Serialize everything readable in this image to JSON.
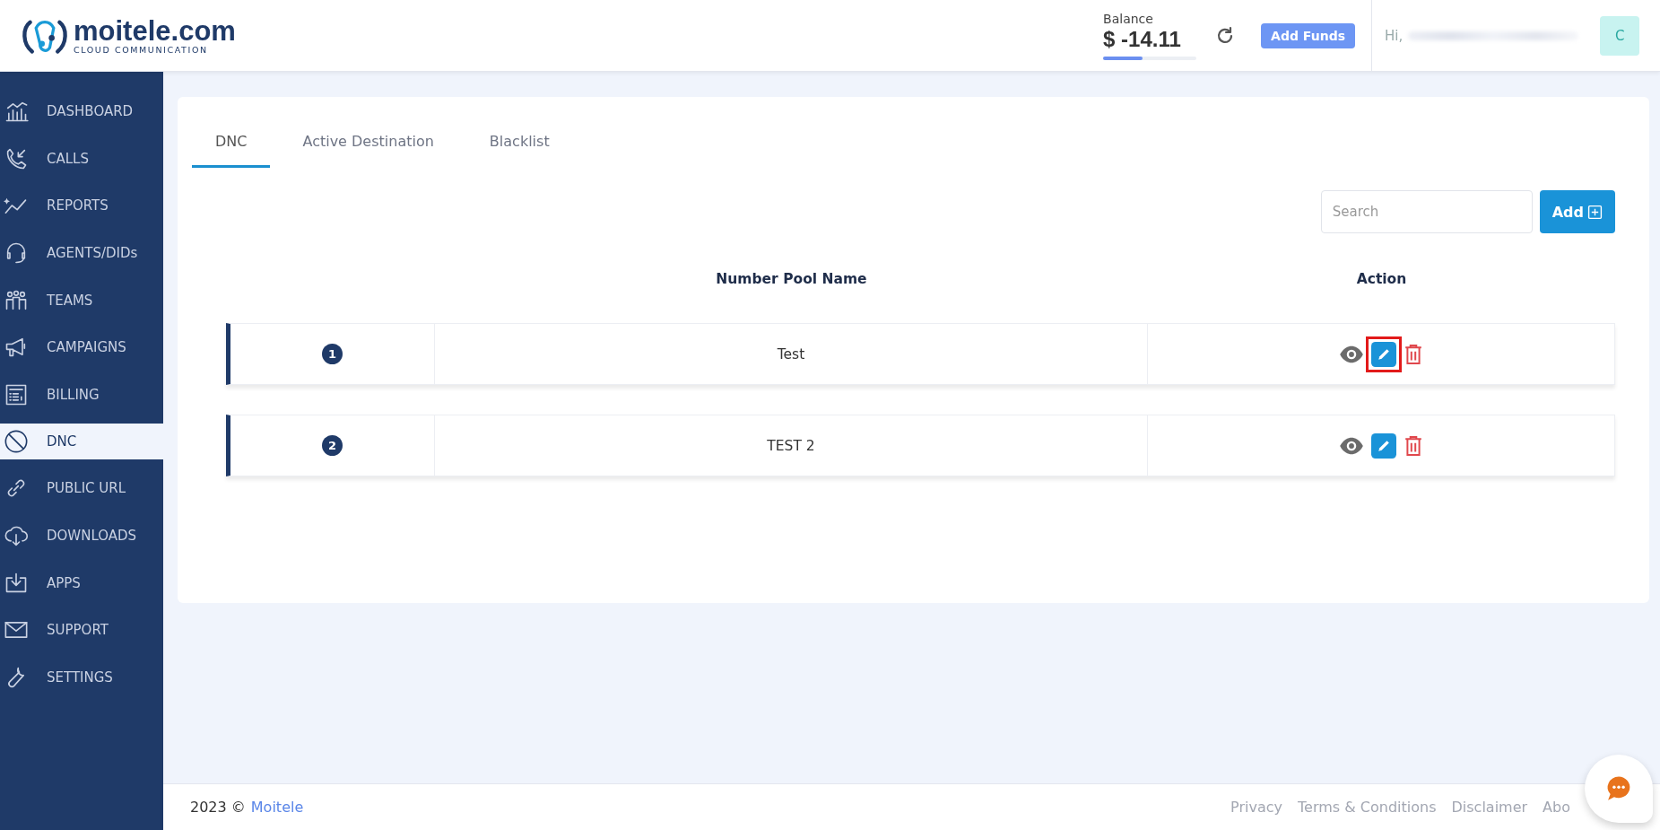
{
  "header": {
    "logo_name": "moitele.com",
    "logo_tagline": "CLOUD COMMUNICATION",
    "balance_label": "Balance",
    "balance_amount": "$ -14.11",
    "balance_level": {
      "level": 0.42
    },
    "add_funds": "Add Funds",
    "greeting": "Hi,",
    "avatar": "C"
  },
  "sidebar": {
    "items": [
      {
        "label": "DASHBOARD",
        "selected": false
      },
      {
        "label": "CALLS",
        "selected": false
      },
      {
        "label": "REPORTS",
        "selected": false
      },
      {
        "label": "AGENTS/DIDs",
        "selected": false
      },
      {
        "label": "TEAMS",
        "selected": false
      },
      {
        "label": "CAMPAIGNS",
        "selected": false
      },
      {
        "label": "BILLING",
        "selected": false
      },
      {
        "label": "DNC",
        "selected": true
      },
      {
        "label": "PUBLIC URL",
        "selected": false
      },
      {
        "label": "DOWNLOADS",
        "selected": false
      },
      {
        "label": "APPS",
        "selected": false
      },
      {
        "label": "SUPPORT",
        "selected": false
      },
      {
        "label": "SETTINGS",
        "selected": false
      }
    ]
  },
  "tabs": [
    {
      "label": "DNC",
      "selected": true
    },
    {
      "label": "Active Destination",
      "selected": false
    },
    {
      "label": "Blacklist",
      "selected": false
    }
  ],
  "search": {
    "placeholder": "Search"
  },
  "add_button": "Add",
  "table": {
    "columns": [
      "Number Pool Name",
      "Action"
    ],
    "rows": [
      {
        "index": "1",
        "name": "Test",
        "highlighted": true
      },
      {
        "index": "2",
        "name": "TEST 2",
        "highlighted": false
      }
    ]
  },
  "footer": {
    "copyright": "2023 ©",
    "brand": "Moitele",
    "links": [
      "Privacy",
      "Terms & Conditions",
      "Disclaimer",
      "Abo"
    ]
  }
}
